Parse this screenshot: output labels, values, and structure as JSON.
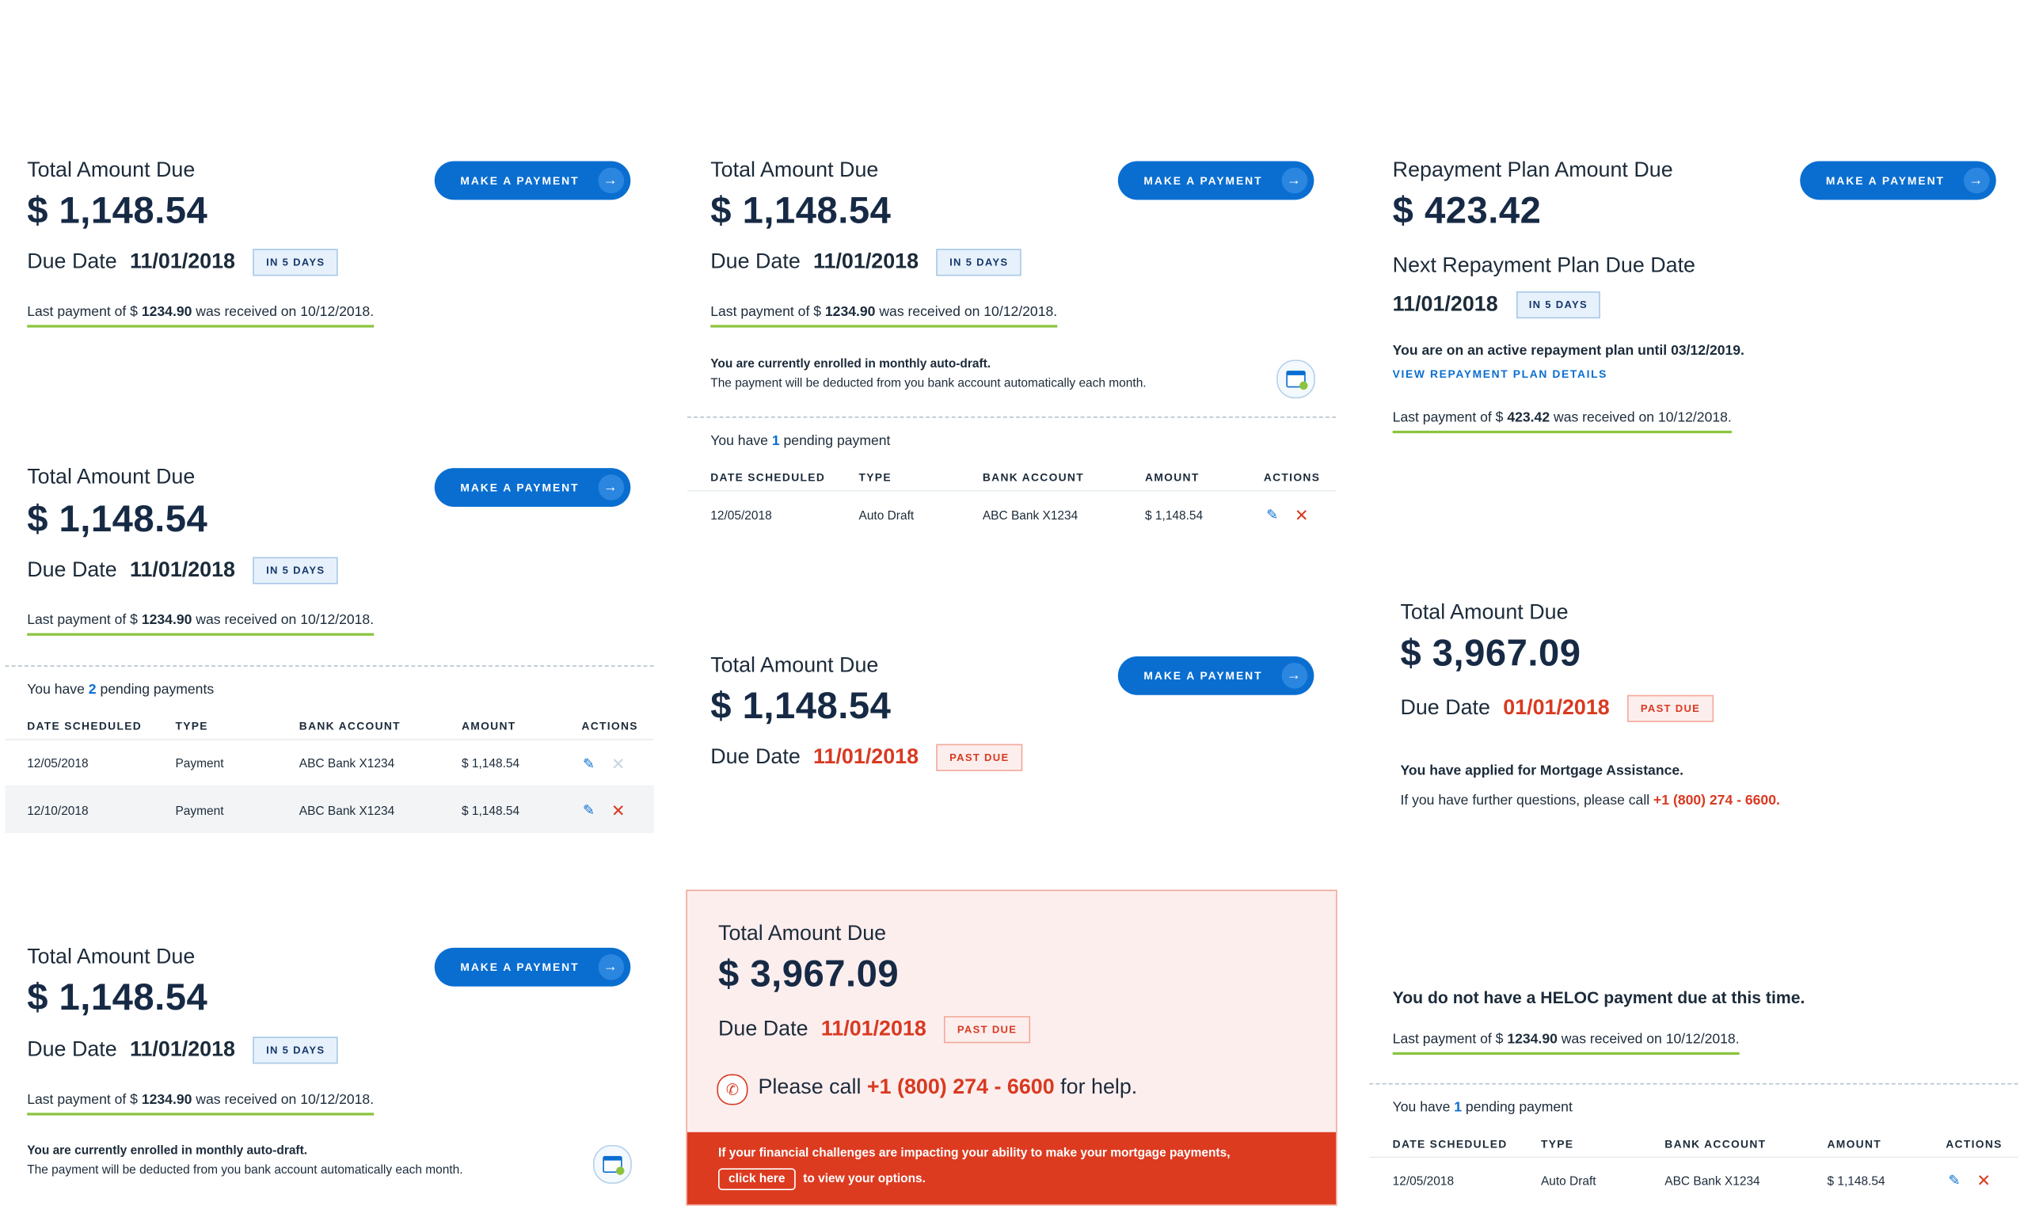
{
  "common": {
    "total_label": "Total Amount Due",
    "amount": "$ 1,148.54",
    "due_label": "Due Date",
    "due_date": "11/01/2018",
    "in_days": "IN 5 DAYS",
    "past_due": "PAST DUE",
    "make_payment": "MAKE A PAYMENT",
    "last_pay_prefix": "Last payment of $",
    "last_pay_amount": "1234.90",
    "last_pay_suffix": "was received on 10/12/2018.",
    "enroll_title": "You are currently enrolled in monthly auto-draft.",
    "enroll_text": "The payment will be deducted from you bank account automatically each month.",
    "pending_prefix": "You have",
    "pending_single": "pending payment",
    "pending_plural": "pending payments"
  },
  "table": {
    "headers": [
      "DATE SCHEDULED",
      "TYPE",
      "BANK ACCOUNT",
      "AMOUNT",
      "ACTIONS"
    ],
    "row_auto": [
      "12/05/2018",
      "Auto Draft",
      "ABC Bank X1234",
      "$ 1,148.54"
    ],
    "row_pay1": [
      "12/05/2018",
      "Payment",
      "ABC Bank X1234",
      "$ 1,148.54"
    ],
    "row_pay2": [
      "12/10/2018",
      "Payment",
      "ABC Bank X1234",
      "$ 1,148.54"
    ]
  },
  "pending_counts": {
    "two": "2",
    "one": "1"
  },
  "repayment": {
    "title": "Repayment Plan Amount Due",
    "amount": "$ 423.42",
    "next_label": "Next Repayment Plan Due Date",
    "date": "11/01/2018",
    "active_text": "You are on an active repayment plan until 03/12/2019.",
    "view_link": "VIEW REPAYMENT PLAN DETAILS",
    "last_pay_amount": "423.42"
  },
  "assistance": {
    "amount": "$ 3,967.09",
    "due_date": "01/01/2018",
    "applied": "You have applied for Mortgage Assistance.",
    "questions": "If you have further questions, please call",
    "phone": "+1 (800) 274 - 6600."
  },
  "pastdue_box": {
    "amount": "$ 3,967.09",
    "due_date": "11/01/2018",
    "call_prefix": "Please call",
    "phone": "+1 (800) 274 - 6600",
    "call_suffix": "for help.",
    "banner_text": "If your financial challenges are impacting your ability to make your mortgage payments,",
    "click_here": "click here",
    "banner_suffix": "to view your options."
  },
  "heloc": {
    "title": "You do not have a HELOC payment due at this time."
  },
  "colors": {
    "primary": "#0a6ed1",
    "danger": "#d83a21",
    "navy": "#172a45",
    "accent_green": "#8ac43f"
  }
}
